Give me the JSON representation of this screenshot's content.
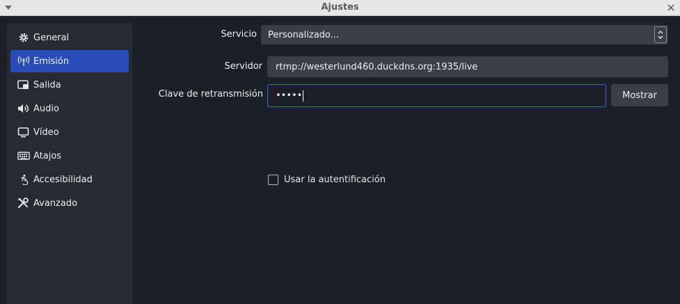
{
  "window": {
    "title": "Ajustes"
  },
  "sidebar": {
    "items": [
      {
        "label": "General",
        "icon": "gear-icon",
        "active": false
      },
      {
        "label": "Emisión",
        "icon": "broadcast-icon",
        "active": true
      },
      {
        "label": "Salida",
        "icon": "output-icon",
        "active": false
      },
      {
        "label": "Audio",
        "icon": "speaker-icon",
        "active": false
      },
      {
        "label": "Vídeo",
        "icon": "monitor-icon",
        "active": false
      },
      {
        "label": "Atajos",
        "icon": "keyboard-icon",
        "active": false
      },
      {
        "label": "Accesibilidad",
        "icon": "accessibility-icon",
        "active": false
      },
      {
        "label": "Avanzado",
        "icon": "tools-icon",
        "active": false
      }
    ]
  },
  "form": {
    "service_label": "Servicio",
    "service_value": "Personalizado...",
    "server_label": "Servidor",
    "server_value": "rtmp://westerlund460.duckdns.org:1935/live",
    "key_label": "Clave de retransmisión",
    "key_value": "•••••",
    "show_button": "Mostrar",
    "auth_checkbox_label": "Usar la autentificación",
    "auth_checked": false
  },
  "colors": {
    "background": "#1d1f28",
    "sidebar": "#272a33",
    "accent": "#284cb8",
    "field": "#3b3e48",
    "focus_border": "#3c66d9"
  }
}
